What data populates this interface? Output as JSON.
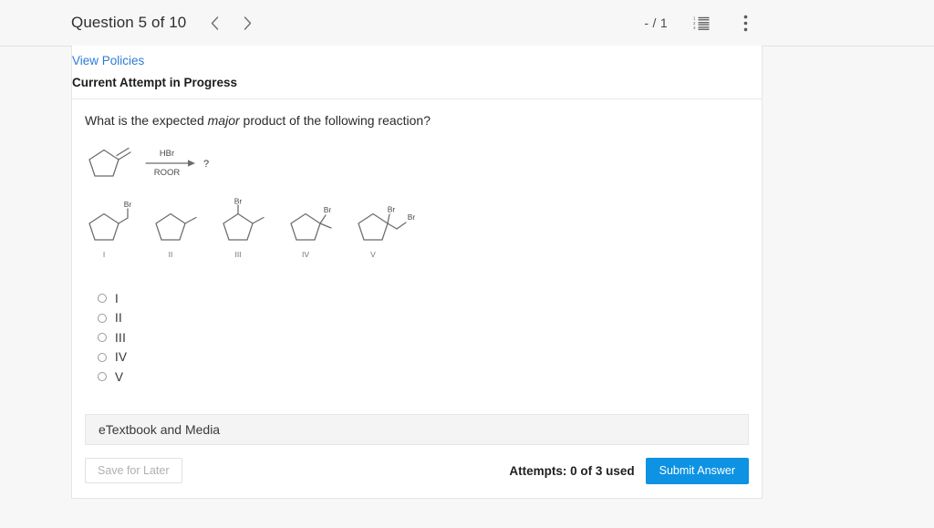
{
  "header": {
    "question_title": "Question 5 of 10",
    "prev_icon": "chevron-left-icon",
    "next_icon": "chevron-right-icon",
    "score": "- / 1",
    "list_icon": "numbered-list-icon",
    "menu_icon": "kebab-menu-icon"
  },
  "card": {
    "policies_link": "View Policies",
    "attempt_status": "Current Attempt in Progress",
    "question": {
      "before_emphasis": "What is the expected ",
      "emphasis": "major",
      "after_emphasis": " product of the following reaction?"
    },
    "reaction": {
      "reagent_above": "HBr",
      "reagent_below": "ROOR",
      "product_placeholder": "?"
    },
    "structures": [
      {
        "label": "I",
        "substituents": "Br on exocyclic CH2"
      },
      {
        "label": "II",
        "substituents": "methyl"
      },
      {
        "label": "III",
        "substituents": "Br and methyl on adjacent carbons"
      },
      {
        "label": "IV",
        "substituents": "Br and methyl on same carbon"
      },
      {
        "label": "V",
        "substituents": "Br on ring carbon and Br on exocyclic CH2"
      }
    ],
    "structure_atom_labels": {
      "br": "Br"
    },
    "options": [
      {
        "label": "I",
        "selected": false
      },
      {
        "label": "II",
        "selected": false
      },
      {
        "label": "III",
        "selected": false
      },
      {
        "label": "IV",
        "selected": false
      },
      {
        "label": "V",
        "selected": false
      }
    ],
    "etextbook_label": "eTextbook and Media",
    "footer": {
      "save_for_later": "Save for Later",
      "attempts": "Attempts: 0 of 3 used",
      "submit": "Submit Answer"
    }
  },
  "colors": {
    "link_blue": "#2b7cd3",
    "submit_blue": "#0e92e3",
    "page_bg": "#f7f7f7",
    "card_bg": "#ffffff",
    "chem_stroke": "#6b6b6b"
  }
}
